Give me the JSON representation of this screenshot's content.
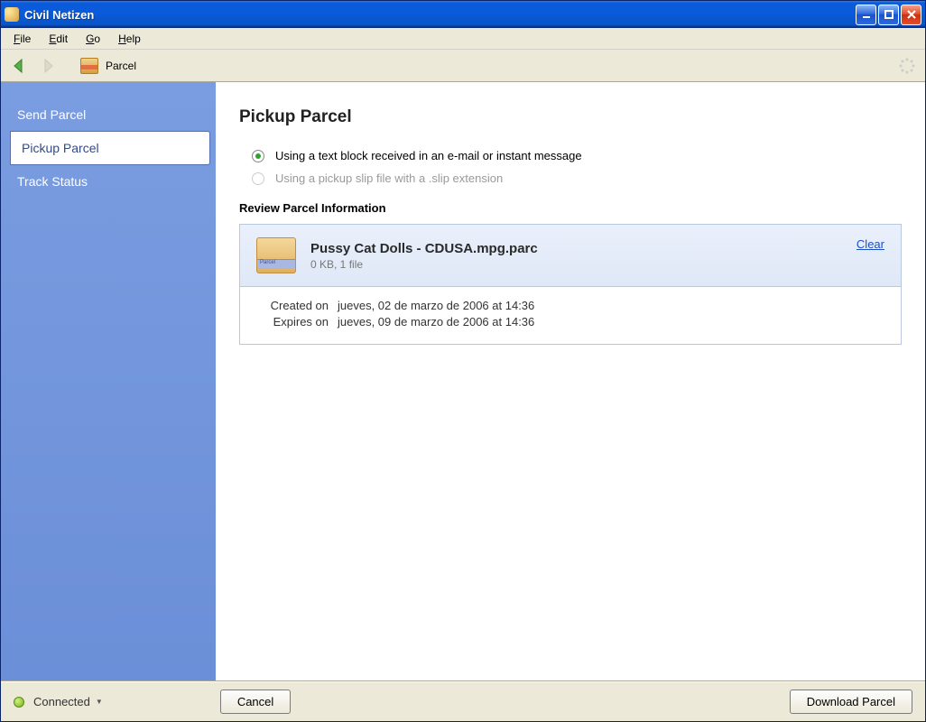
{
  "window": {
    "title": "Civil Netizen"
  },
  "menu": {
    "file": "File",
    "edit": "Edit",
    "go": "Go",
    "help": "Help"
  },
  "toolbar": {
    "breadcrumb": "Parcel"
  },
  "sidebar": {
    "items": [
      {
        "label": "Send Parcel",
        "active": false
      },
      {
        "label": "Pickup Parcel",
        "active": true
      },
      {
        "label": "Track Status",
        "active": false
      }
    ]
  },
  "main": {
    "title": "Pickup Parcel",
    "radios": {
      "option1": "Using a text block received in an e-mail or instant message",
      "option2": "Using a pickup slip file with a .slip extension"
    },
    "review_label": "Review Parcel Information",
    "parcel": {
      "name": "Pussy Cat Dolls - CDUSA.mpg.parc",
      "sub": "0 KB, 1 file",
      "clear": "Clear",
      "created_label": "Created on",
      "created_value": "jueves, 02 de marzo de 2006 at 14:36",
      "expires_label": "Expires on",
      "expires_value": "jueves, 09 de marzo de 2006 at 14:36"
    }
  },
  "status": {
    "text": "Connected",
    "cancel": "Cancel",
    "download": "Download Parcel"
  }
}
